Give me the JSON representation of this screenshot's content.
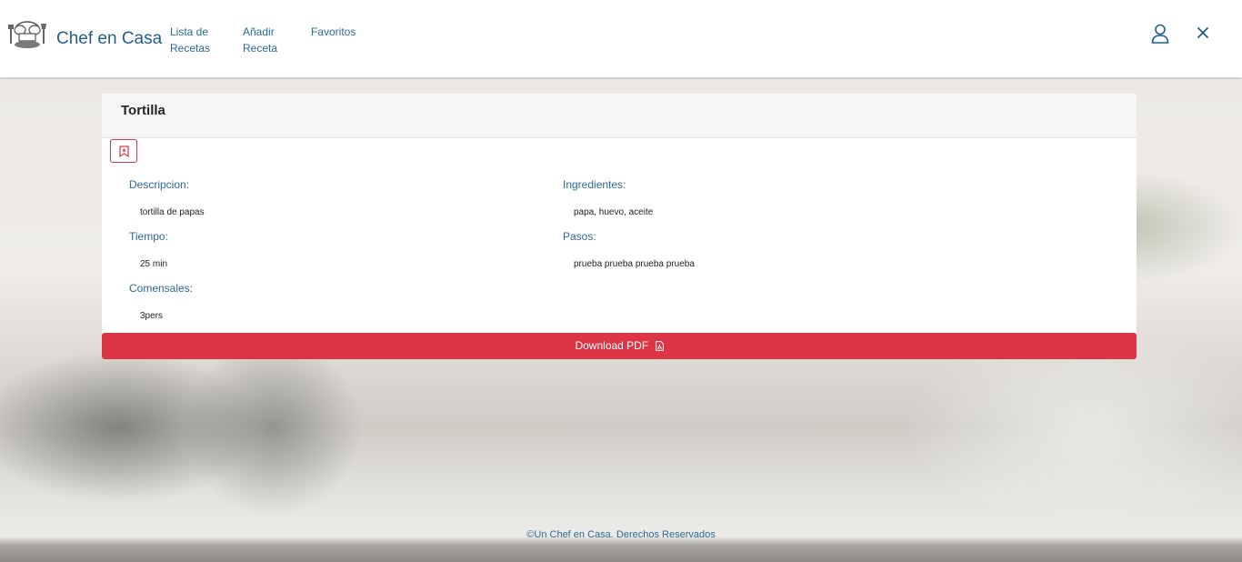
{
  "header": {
    "brand": "Chef en Casa",
    "logo_icon": "chef-hat-logo",
    "nav": [
      {
        "label": "Lista de Recetas"
      },
      {
        "label": "Añadir Receta"
      },
      {
        "label": "Favoritos"
      }
    ],
    "user_icon": "user-icon",
    "close_icon": "close-icon"
  },
  "recipe": {
    "title": "Tortilla",
    "bookmark_icon": "bookmark-icon",
    "fields": {
      "descripcion_label": "Descripcion:",
      "descripcion_value": "tortilla de papas",
      "tiempo_label": "Tiempo:",
      "tiempo_value": "25 min",
      "comensales_label": "Comensales:",
      "comensales_value": "3pers",
      "ingredientes_label": "Ingredientes:",
      "ingredientes_value": "papa, huevo, aceite",
      "pasos_label": "Pasos:",
      "pasos_value": "prueba prueba prueba prueba"
    },
    "download_label": "Download PDF",
    "download_icon": "pdf-file-icon"
  },
  "footer": {
    "text": "©Un Chef en Casa. Derechos Reservados"
  },
  "colors": {
    "brand_blue": "#1f5f8b",
    "accent_red": "#dc3545"
  }
}
